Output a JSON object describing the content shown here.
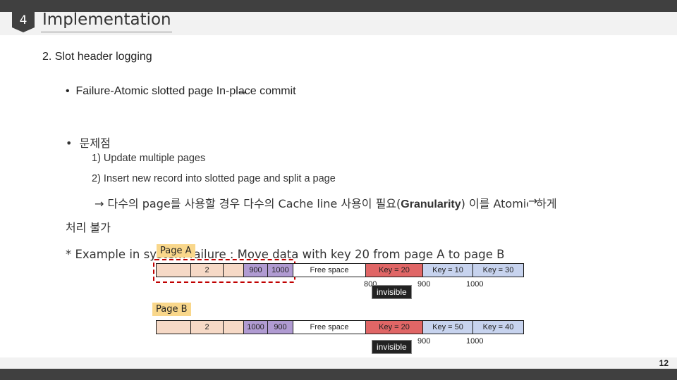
{
  "header": {
    "section_number": "4",
    "title": "Implementation"
  },
  "content": {
    "heading": "2.  Slot header logging",
    "bullet1": "Failure-Atomic slotted page  In-place commit",
    "bullet2": "문제점",
    "item1": "1) Update multiple pages",
    "item2": "2) Insert new record into slotted page and split a page",
    "line_a": " 다수의 page를 사용할 경우 다수의 Cache line 사용이 필요(",
    "line_a_bold": "Granularity",
    "line_a_end": ")  이를 Atomic 하게",
    "line_b": "처리 불가",
    "example": "* Example in system failure : Move data with key 20 from page A to page B"
  },
  "diagram": {
    "page_a_label": "Page A",
    "page_b_label": "Page B",
    "page_a": {
      "slot_count": "2",
      "slot1": "900",
      "slot2": "1000",
      "free_space": "Free space",
      "key1": "Key = 20",
      "key2": "Key = 10",
      "key3": "Key = 30",
      "off1": "800",
      "off2": "900",
      "off3": "1000",
      "invisible": "invisible"
    },
    "page_b": {
      "slot_count": "2",
      "slot1": "1000",
      "slot2": "900",
      "free_space": "Free space",
      "key1": "Key = 20",
      "key2": "Key = 50",
      "key3": "Key = 40",
      "off2": "900",
      "off3": "1000",
      "invisible": "invisible"
    }
  },
  "footer": {
    "page_number": "12"
  }
}
